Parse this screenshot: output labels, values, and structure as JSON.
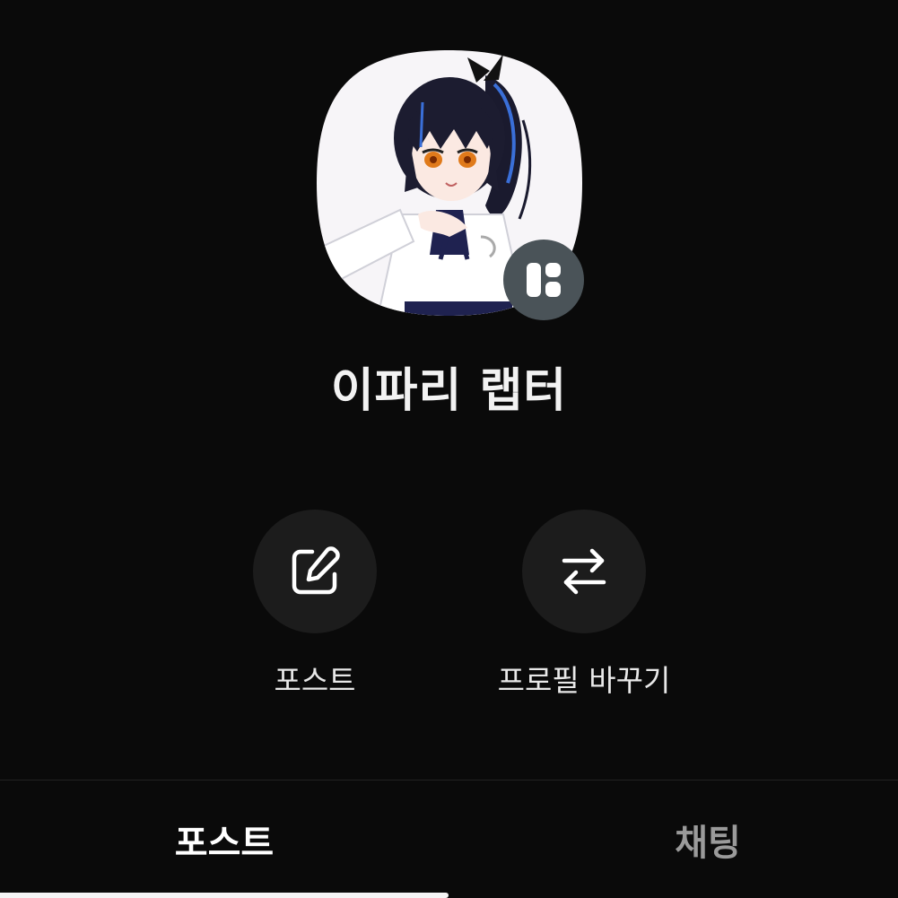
{
  "profile": {
    "name": "이파리 랩터",
    "avatar_icon": "anime-character-avatar",
    "badge_icon": "grid-layout-icon"
  },
  "actions": [
    {
      "label": "포스트",
      "icon": "edit-icon"
    },
    {
      "label": "프로필 바꾸기",
      "icon": "swap-arrows-icon"
    }
  ],
  "tabs": {
    "posts": "포스트",
    "chat": "채팅",
    "selected": "포스트"
  },
  "colors": {
    "background": "#0a0a0a",
    "action_circle": "#1c1c1c",
    "badge": "#4a5358",
    "inactive_tab": "#9a9a9a"
  }
}
